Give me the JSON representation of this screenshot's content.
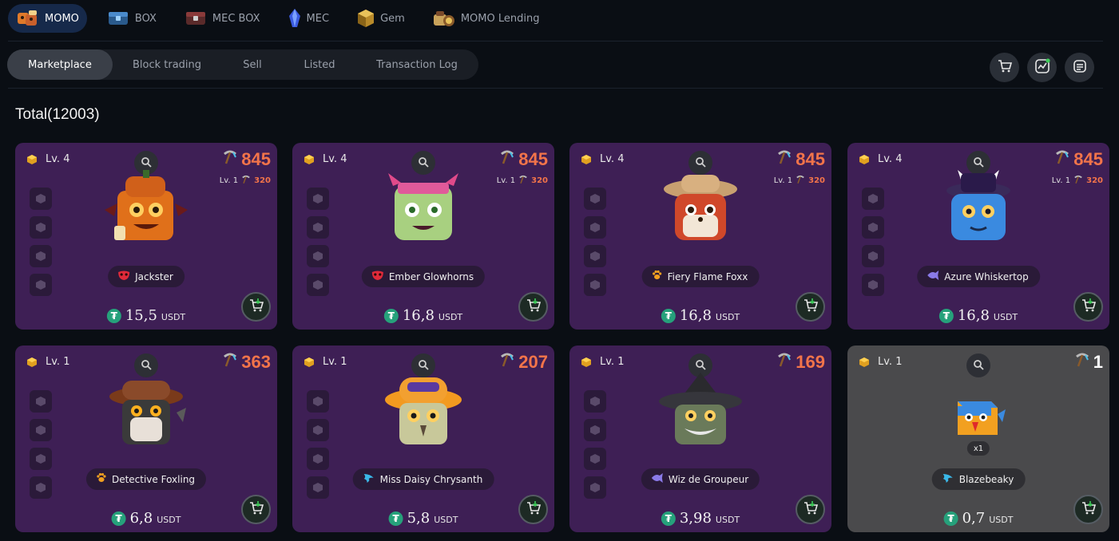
{
  "topnav": [
    {
      "label": "MOMO",
      "icon": "momo-icon",
      "active": true
    },
    {
      "label": "BOX",
      "icon": "box-icon",
      "active": false
    },
    {
      "label": "MEC BOX",
      "icon": "mec-box-icon",
      "active": false
    },
    {
      "label": "MEC",
      "icon": "mec-crystal-icon",
      "active": false
    },
    {
      "label": "Gem",
      "icon": "gem-icon",
      "active": false
    },
    {
      "label": "MOMO Lending",
      "icon": "momo-lending-icon",
      "active": false
    }
  ],
  "subtabs": [
    {
      "label": "Marketplace",
      "active": true
    },
    {
      "label": "Block trading",
      "active": false
    },
    {
      "label": "Sell",
      "active": false
    },
    {
      "label": "Listed",
      "active": false
    },
    {
      "label": "Transaction Log",
      "active": false
    }
  ],
  "actions": [
    "cart-icon",
    "chart-icon",
    "list-icon"
  ],
  "total_label": "Total(12003)",
  "colors": {
    "card_purple": "#3e1f55",
    "card_gray": "#4a4a4c",
    "accent_orange": "#f2744a",
    "tether_green": "#26a17b",
    "active_nav": "#16294a"
  },
  "cards": [
    {
      "level": "Lv. 4",
      "power": "845",
      "sub_level": "Lv. 1",
      "sub_power": "320",
      "name": "Jackster",
      "name_icon": "red-mask-icon",
      "price": "15,5",
      "unit": "USDT",
      "style": "purple"
    },
    {
      "level": "Lv. 4",
      "power": "845",
      "sub_level": "Lv. 1",
      "sub_power": "320",
      "name": "Ember Glowhorns",
      "name_icon": "red-mask-icon",
      "price": "16,8",
      "unit": "USDT",
      "style": "purple"
    },
    {
      "level": "Lv. 4",
      "power": "845",
      "sub_level": "Lv. 1",
      "sub_power": "320",
      "name": "Fiery Flame Foxx",
      "name_icon": "paw-icon",
      "price": "16,8",
      "unit": "USDT",
      "style": "purple"
    },
    {
      "level": "Lv. 4",
      "power": "845",
      "sub_level": "Lv. 1",
      "sub_power": "320",
      "name": "Azure Whiskertop",
      "name_icon": "fish-icon",
      "price": "16,8",
      "unit": "USDT",
      "style": "purple"
    },
    {
      "level": "Lv. 1",
      "power": "363",
      "sub_level": "",
      "sub_power": "",
      "name": "Detective Foxling",
      "name_icon": "paw-icon",
      "price": "6,8",
      "unit": "USDT",
      "style": "purple"
    },
    {
      "level": "Lv. 1",
      "power": "207",
      "sub_level": "",
      "sub_power": "",
      "name": "Miss Daisy Chrysanth",
      "name_icon": "wing-icon",
      "price": "5,8",
      "unit": "USDT",
      "style": "purple"
    },
    {
      "level": "Lv. 1",
      "power": "169",
      "sub_level": "",
      "sub_power": "",
      "name": "Wiz de Groupeur",
      "name_icon": "fish-icon",
      "price": "3,98",
      "unit": "USDT",
      "style": "purple"
    },
    {
      "level": "Lv. 1",
      "power": "1",
      "sub_level": "",
      "sub_power": "",
      "name": "Blazebeaky",
      "name_icon": "wing-icon",
      "price": "0,7",
      "unit": "USDT",
      "style": "gray",
      "quantity": "x1"
    }
  ]
}
